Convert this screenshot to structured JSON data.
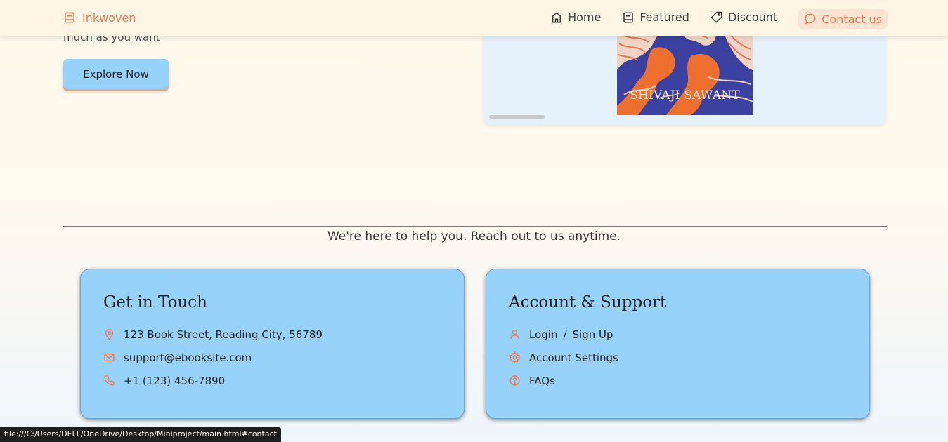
{
  "navbar": {
    "brand": "Inkwoven",
    "links": [
      {
        "label": "Home",
        "icon": "home-icon"
      },
      {
        "label": "Featured",
        "icon": "book-icon"
      },
      {
        "label": "Discount",
        "icon": "tag-icon"
      },
      {
        "label": "Contact us",
        "icon": "chat-icon",
        "active": true
      }
    ]
  },
  "hero": {
    "text": "much as you want",
    "button_label": "Explore Now"
  },
  "carousel": {
    "book_author": "SHIVAJI SAWANT"
  },
  "contact": {
    "subtitle": "We're here to help you. Reach out to us anytime.",
    "get_in_touch": {
      "title": "Get in Touch",
      "address": "123 Book Street, Reading City, 56789",
      "email": "support@ebooksite.com",
      "phone": "+1 (123) 456-7890"
    },
    "account": {
      "title": "Account & Support",
      "login": "Login",
      "separator": "/",
      "signup": "Sign Up",
      "settings": "Account Settings",
      "faqs": "FAQs"
    }
  },
  "status_bar": {
    "url": "file:///C:/Users/DELL/OneDrive/Desktop/Miniproject/main.html#contact"
  },
  "colors": {
    "accent": "#f07b50",
    "card": "#96d2fa",
    "navbar": "#fff5e4"
  }
}
